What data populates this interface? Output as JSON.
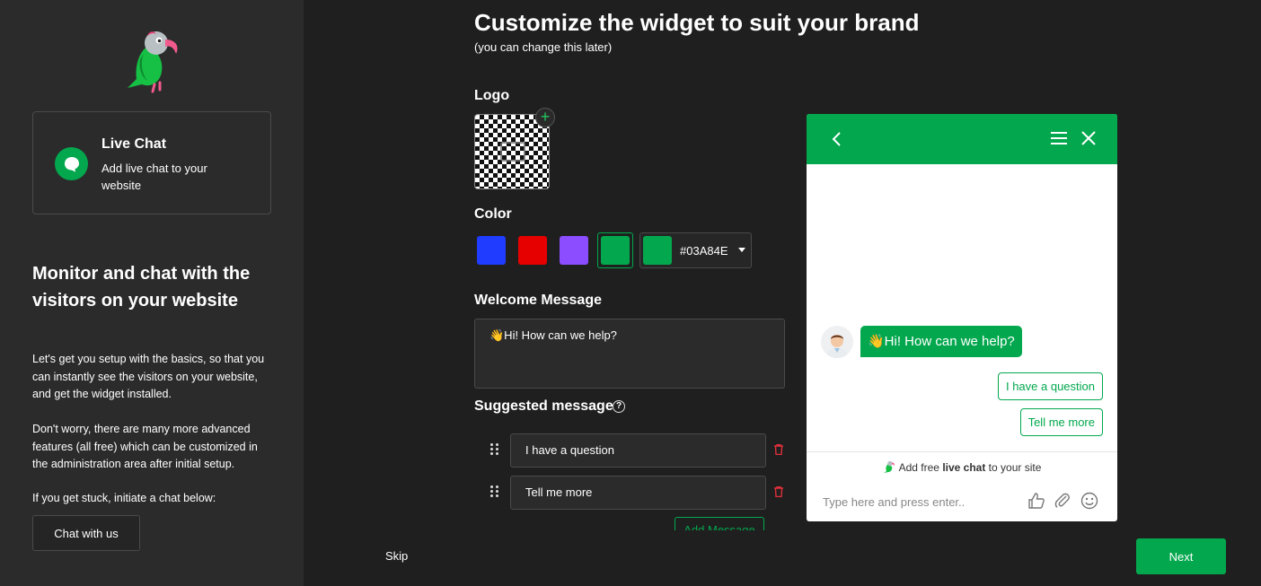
{
  "sidebar": {
    "product": {
      "title": "Live Chat",
      "description": "Add live chat to your website"
    },
    "heading": "Monitor and chat with the visitors on your website",
    "paragraphs": [
      "Let's get you setup with the basics, so that you can instantly see the visitors on your website, and get the widget installed.",
      "Don't worry, there are many more advanced features (all free) which can be customized in the administration area after initial setup.",
      "If you get stuck, initiate a chat below:"
    ],
    "chat_button": "Chat with us"
  },
  "main": {
    "title": "Customize the widget to suit your brand",
    "subtitle": "(you can change this later)",
    "logo_label": "Logo",
    "color_label": "Color",
    "colors": [
      "#1f3cff",
      "#e60000",
      "#8b4dff",
      "#03a84e"
    ],
    "selected_color": "#03A84E",
    "welcome_label": "Welcome Message",
    "welcome_message": "👋Hi! How can we help?",
    "suggested_label": "Suggested message",
    "suggested_messages": [
      "I have a question",
      "Tell me more"
    ],
    "add_message": "Add Message",
    "skip": "Skip",
    "next": "Next"
  },
  "widget": {
    "greeting": "👋Hi! How can we help?",
    "suggestions": [
      "I have a question",
      "Tell me more"
    ],
    "branding_prefix": "Add free ",
    "branding_bold": "live chat",
    "branding_suffix": " to your site",
    "input_placeholder": "Type here and press enter.."
  },
  "icons": {
    "brand_logo": "parrot-logo-icon",
    "product": "chat-bubble-icon",
    "help": "question-circle-icon",
    "drag": "drag-handle-icon",
    "delete": "trash-icon",
    "widget_tools": [
      "thumbs-up-icon",
      "paperclip-icon",
      "smiley-icon"
    ]
  }
}
